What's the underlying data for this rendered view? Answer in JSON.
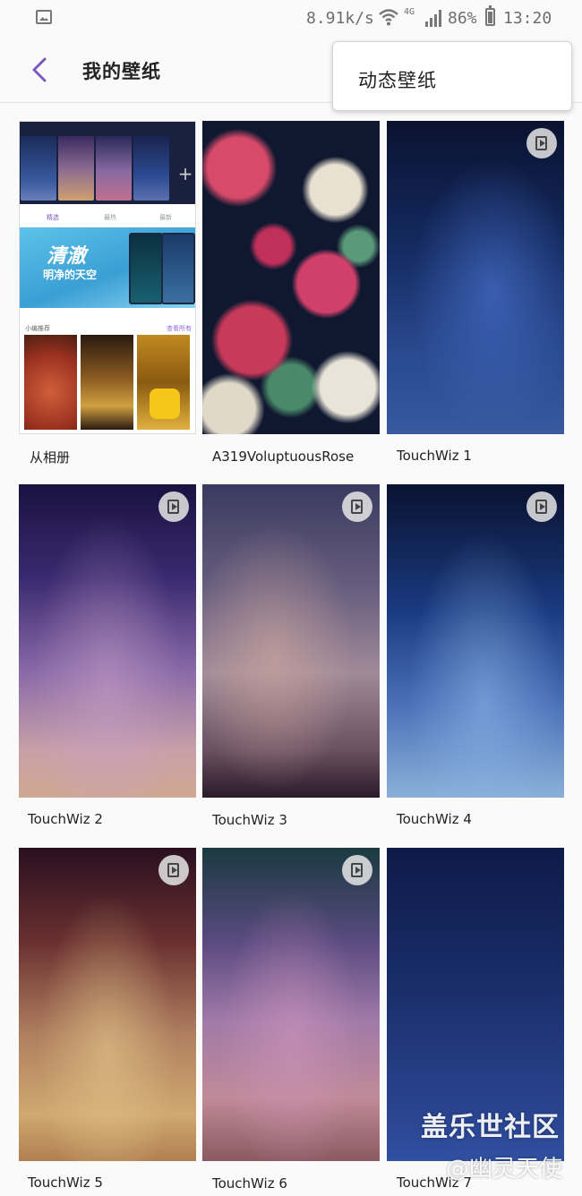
{
  "status_bar": {
    "network_speed": "8.91k/s",
    "network_type": "4G",
    "battery_percent": "86%",
    "time": "13:20"
  },
  "header": {
    "title": "我的壁纸",
    "menu_item": "动态壁纸"
  },
  "album_tile": {
    "tabs": [
      "精选",
      "最热",
      "最新"
    ],
    "banner_title": "清澈",
    "banner_subtitle": "明净的天空",
    "section_left": "小编推荐",
    "section_right": "查看所有"
  },
  "wallpapers": [
    {
      "label": "从相册"
    },
    {
      "label": "A319VoluptuousRose"
    },
    {
      "label": "TouchWiz 1"
    },
    {
      "label": "TouchWiz 2"
    },
    {
      "label": "TouchWiz 3"
    },
    {
      "label": "TouchWiz 4"
    },
    {
      "label": "TouchWiz 5"
    },
    {
      "label": "TouchWiz 6"
    },
    {
      "label": "TouchWiz 7"
    }
  ],
  "watermark": {
    "line1": "盖乐世社区",
    "line2": "@幽灵天使"
  },
  "colors": {
    "accent": "#7e57c2",
    "background": "#fafafa"
  }
}
